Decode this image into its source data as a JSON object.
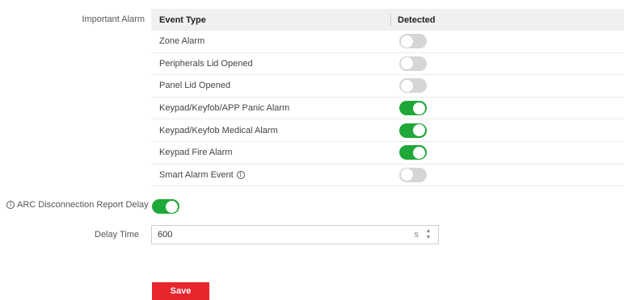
{
  "important_alarm": {
    "label": "Important Alarm",
    "header_event": "Event Type",
    "header_detected": "Detected",
    "rows": [
      {
        "event": "Zone Alarm",
        "detected": false
      },
      {
        "event": "Peripherals Lid Opened",
        "detected": false
      },
      {
        "event": "Panel Lid Opened",
        "detected": false
      },
      {
        "event": "Keypad/Keyfob/APP Panic Alarm",
        "detected": true
      },
      {
        "event": "Keypad/Keyfob Medical Alarm",
        "detected": true
      },
      {
        "event": "Keypad Fire Alarm",
        "detected": true
      },
      {
        "event": "Smart Alarm Event",
        "detected": false,
        "info": true
      }
    ]
  },
  "arc": {
    "label": "ARC Disconnection Report Delay",
    "enabled": true,
    "info_icon": "info-icon"
  },
  "delay": {
    "label": "Delay Time",
    "value": "600",
    "unit": "s"
  },
  "save_label": "Save",
  "colors": {
    "toggle_on": "#1fa838",
    "toggle_off": "#d6d6d6",
    "save": "#e8262d",
    "header_bg": "#f0f0f0"
  }
}
